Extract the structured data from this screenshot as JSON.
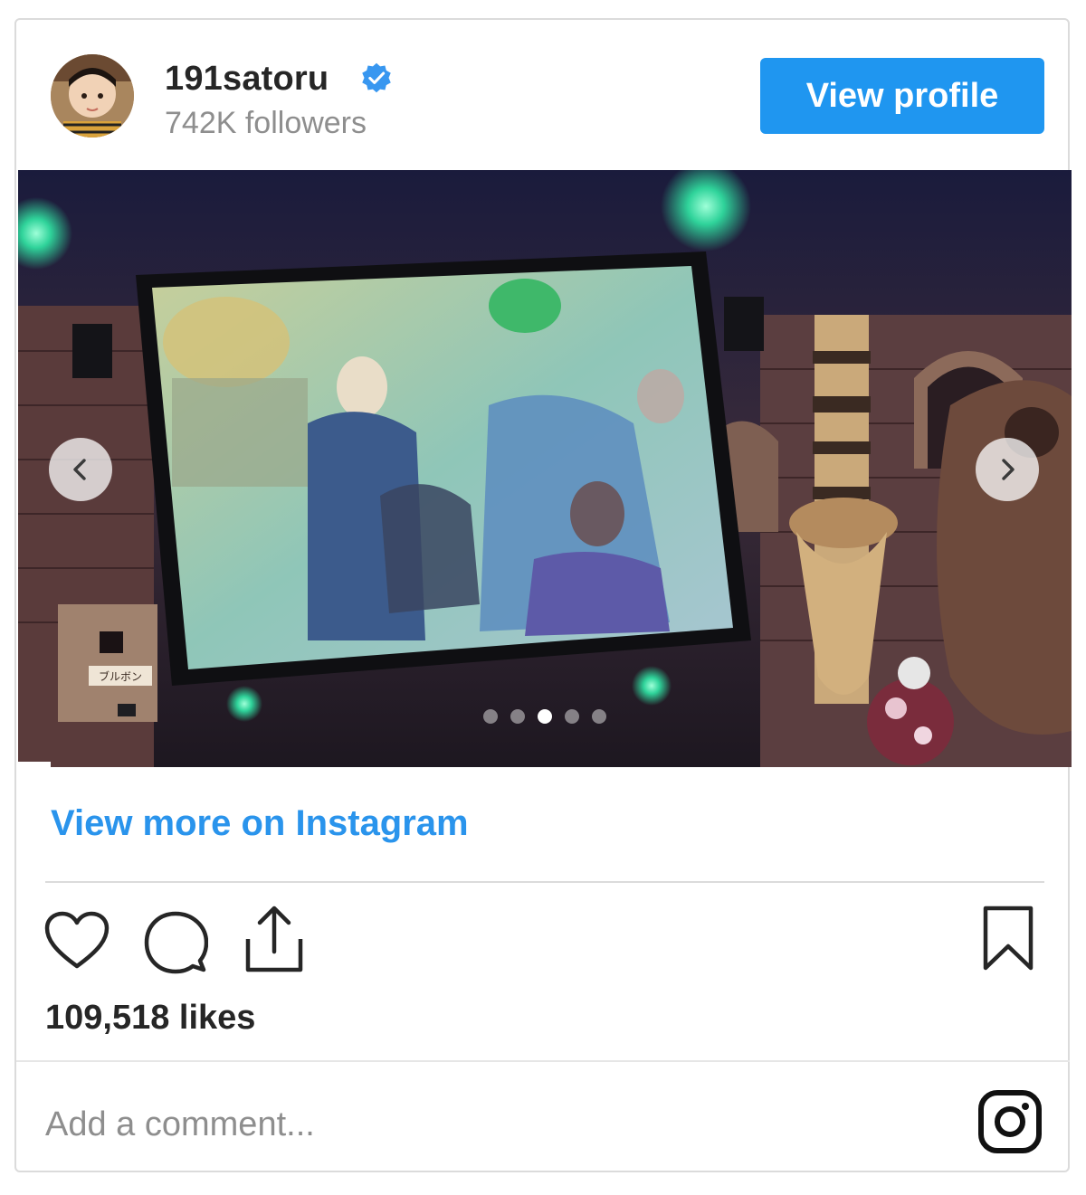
{
  "header": {
    "username": "191satoru",
    "verified": true,
    "followers": "742K followers",
    "view_profile_label": "View profile",
    "accent_color": "#1f96f0"
  },
  "media": {
    "carousel_total": 5,
    "carousel_active_index": 3,
    "sign_text": "ブルボン",
    "prev_icon": "chevron-left-icon",
    "next_icon": "chevron-right-icon"
  },
  "view_more_label": "View more on Instagram",
  "actions": {
    "icons": [
      "heart-icon",
      "comment-icon",
      "share-icon",
      "bookmark-icon"
    ]
  },
  "likes": "109,518 likes",
  "comment": {
    "placeholder": "Add a comment..."
  },
  "footer": {
    "icon": "instagram-icon"
  }
}
